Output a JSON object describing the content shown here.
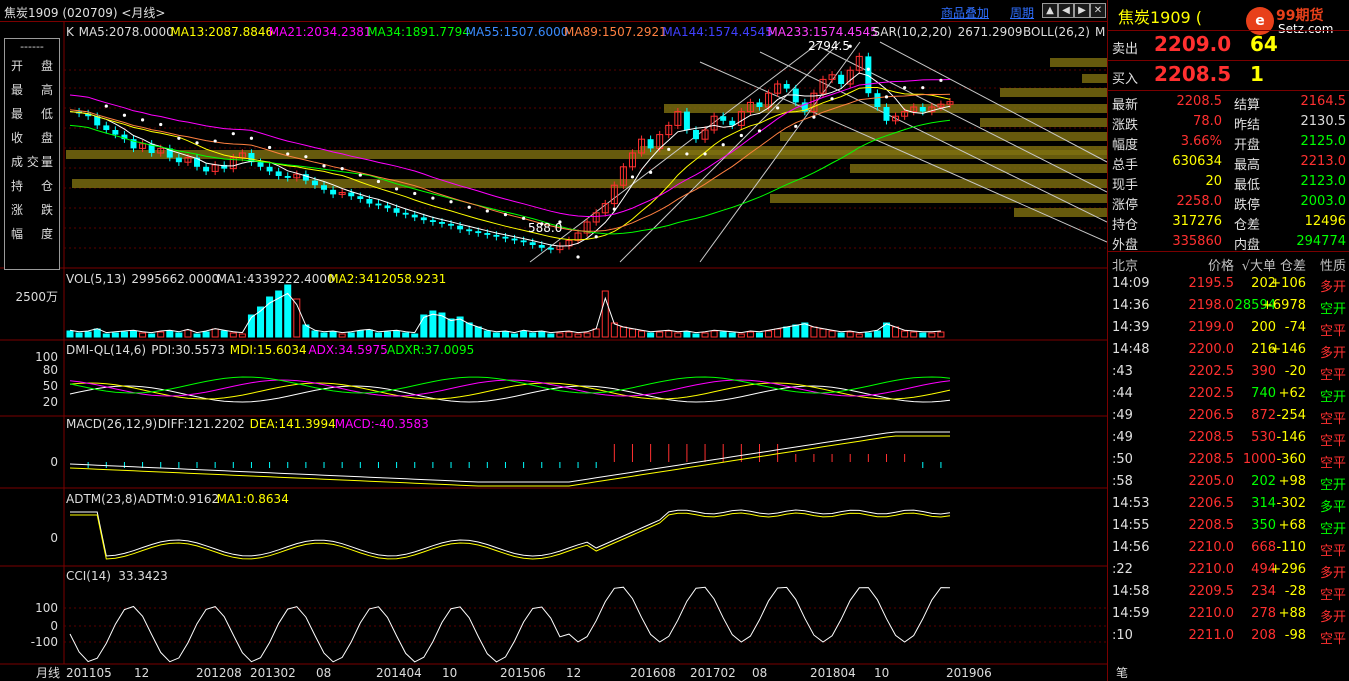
{
  "titlebar": {
    "title": "焦炭1909 (020709) <月线>",
    "overlay_link": "商品叠加",
    "period_link": "周期"
  },
  "side_panel": {
    "dashes": "------",
    "rows": [
      {
        "a": "开",
        "b": "盘"
      },
      {
        "a": "最",
        "b": "高"
      },
      {
        "a": "最",
        "b": "低"
      },
      {
        "a": "收",
        "b": "盘"
      },
      {
        "a": "成 交",
        "b": "量"
      },
      {
        "a": "持",
        "b": "仓"
      },
      {
        "a": "涨",
        "b": "跌"
      },
      {
        "a": "幅",
        "b": "度"
      }
    ]
  },
  "main_chart": {
    "ma_legend": [
      {
        "text": "K",
        "color": "#dddddd"
      },
      {
        "text": "MA5:2078.0000",
        "color": "#dddddd"
      },
      {
        "text": "MA13:2087.8846",
        "color": "#ffff00"
      },
      {
        "text": "MA21:2034.2381",
        "color": "#ff00ff"
      },
      {
        "text": "MA34:1891.7794",
        "color": "#00ff00"
      },
      {
        "text": "MA55:1507.6000",
        "color": "#3a8cff"
      },
      {
        "text": "MA89:1507.2921",
        "color": "#ff8040"
      },
      {
        "text": "MA144:1574.4545",
        "color": "#4040ff"
      },
      {
        "text": "MA233:1574.4545",
        "color": "#ff40ff"
      },
      {
        "text": "SAR(10,2,20)",
        "color": "#dddddd"
      },
      {
        "text": "2671.2909",
        "color": "#dddddd"
      },
      {
        "text": "BOLL(26,2)",
        "color": "#dddddd"
      },
      {
        "text": "M",
        "color": "#dddddd"
      }
    ],
    "high_label": "2794.5",
    "low_label": "588.0"
  },
  "vol_pane": {
    "legend": [
      {
        "text": "VOL(5,13)",
        "color": "#dddddd"
      },
      {
        "text": "2995662.0000",
        "color": "#dddddd"
      },
      {
        "text": "MA1:4339222.4000",
        "color": "#dddddd"
      },
      {
        "text": "MA2:3412058.9231",
        "color": "#ffff00"
      }
    ],
    "y_label": "2500万"
  },
  "dmi_pane": {
    "legend": [
      {
        "text": "DMI-QL(14,6)",
        "color": "#dddddd"
      },
      {
        "text": "PDI:30.5573",
        "color": "#dddddd"
      },
      {
        "text": "MDI:15.6034",
        "color": "#ffff00"
      },
      {
        "text": "ADX:34.5975",
        "color": "#ff00ff"
      },
      {
        "text": "ADXR:37.0095",
        "color": "#00ff00"
      }
    ],
    "y_labels": [
      "100",
      "80",
      "50",
      "20"
    ]
  },
  "macd_pane": {
    "legend": [
      {
        "text": "MACD(26,12,9)",
        "color": "#dddddd"
      },
      {
        "text": "DIFF:121.2202",
        "color": "#dddddd"
      },
      {
        "text": "DEA:141.3994",
        "color": "#ffff00"
      },
      {
        "text": "MACD:-40.3583",
        "color": "#ff00ff"
      }
    ],
    "y_label": "0"
  },
  "adtm_pane": {
    "legend": [
      {
        "text": "ADTM(23,8)",
        "color": "#dddddd"
      },
      {
        "text": "ADTM:0.9162",
        "color": "#dddddd"
      },
      {
        "text": "MA1:0.8634",
        "color": "#ffff00"
      }
    ],
    "y_label": "0"
  },
  "cci_pane": {
    "legend": [
      {
        "text": "CCI(14)",
        "color": "#dddddd"
      },
      {
        "text": "33.3423",
        "color": "#dddddd"
      }
    ],
    "y_labels": [
      "100",
      "0",
      "-100"
    ]
  },
  "x_axis": {
    "period_label": "月线",
    "labels": [
      "201105",
      "12",
      "201208",
      "201302",
      "08",
      "201404",
      "10",
      "201506",
      "12",
      "201608",
      "201702",
      "08",
      "201804",
      "10",
      "201906"
    ]
  },
  "right_panel": {
    "title": "焦炭1909 (",
    "logo_glyph": "e",
    "logo_brand": "99期货",
    "logo_site": "Setz.com",
    "sell": {
      "label": "卖出",
      "price": "2209.0",
      "volume": "64"
    },
    "buy": {
      "label": "买入",
      "price": "2208.5",
      "volume": "1"
    },
    "quotes": [
      {
        "l1": "最新",
        "v1": "2208.5",
        "c1": "#ff3030",
        "l2": "结算",
        "v2": "2164.5",
        "c2": "#ff3030"
      },
      {
        "l1": "涨跌",
        "v1": "78.0",
        "c1": "#ff3030",
        "l2": "昨结",
        "v2": "2130.5",
        "c2": "#dddddd"
      },
      {
        "l1": "幅度",
        "v1": "3.66%",
        "c1": "#ff3030",
        "l2": "开盘",
        "v2": "2125.0",
        "c2": "#00ff00"
      },
      {
        "l1": "总手",
        "v1": "630634",
        "c1": "#ffff00",
        "l2": "最高",
        "v2": "2213.0",
        "c2": "#ff3030"
      },
      {
        "l1": "现手",
        "v1": "20",
        "c1": "#ffff00",
        "l2": "最低",
        "v2": "2123.0",
        "c2": "#00ff00"
      },
      {
        "l1": "涨停",
        "v1": "2258.0",
        "c1": "#ff3030",
        "l2": "跌停",
        "v2": "2003.0",
        "c2": "#00ff00"
      },
      {
        "l1": "持仓",
        "v1": "317276",
        "c1": "#ffff00",
        "l2": "仓差",
        "v2": "12496",
        "c2": "#ffff00"
      },
      {
        "l1": "外盘",
        "v1": "335860",
        "c1": "#ff3030",
        "l2": "内盘",
        "v2": "294774",
        "c2": "#00ff00"
      }
    ],
    "tick_header": {
      "location": "北京",
      "price": "价格",
      "big": "√大单",
      "diff": "仓差",
      "nature": "性质"
    },
    "ticks": [
      {
        "time": "14:09",
        "price": "2195.5",
        "vol": "202",
        "vc": "#ffff00",
        "diff": "+106",
        "nat": "多开",
        "nc": "#ff3030"
      },
      {
        "time": "14:36",
        "price": "2198.0",
        "vol": "28594",
        "vc": "#00ff00",
        "diff": "+6978",
        "nat": "空开",
        "nc": "#00ff00"
      },
      {
        "time": "14:39",
        "price": "2199.0",
        "vol": "200",
        "vc": "#ffff00",
        "diff": "-74",
        "nat": "空平",
        "nc": "#ff3030"
      },
      {
        "time": "14:48",
        "price": "2200.0",
        "vol": "216",
        "vc": "#ffff00",
        "diff": "+146",
        "nat": "多开",
        "nc": "#ff3030"
      },
      {
        "time": ":43",
        "price": "2202.5",
        "vol": "390",
        "vc": "#ff3030",
        "diff": "-20",
        "nat": "空平",
        "nc": "#ff3030"
      },
      {
        "time": ":44",
        "price": "2202.5",
        "vol": "740",
        "vc": "#00ff00",
        "diff": "+62",
        "nat": "空开",
        "nc": "#00ff00"
      },
      {
        "time": ":49",
        "price": "2206.5",
        "vol": "872",
        "vc": "#ff3030",
        "diff": "-254",
        "nat": "空平",
        "nc": "#ff3030"
      },
      {
        "time": ":49",
        "price": "2208.5",
        "vol": "530",
        "vc": "#ff3030",
        "diff": "-146",
        "nat": "空平",
        "nc": "#ff3030"
      },
      {
        "time": ":50",
        "price": "2208.5",
        "vol": "1000",
        "vc": "#ff3030",
        "diff": "-360",
        "nat": "空平",
        "nc": "#ff3030"
      },
      {
        "time": ":58",
        "price": "2205.0",
        "vol": "202",
        "vc": "#00ff00",
        "diff": "+98",
        "nat": "空开",
        "nc": "#00ff00"
      },
      {
        "time": "14:53",
        "price": "2206.5",
        "vol": "314",
        "vc": "#00ff00",
        "diff": "-302",
        "nat": "多平",
        "nc": "#00ff00"
      },
      {
        "time": "14:55",
        "price": "2208.5",
        "vol": "350",
        "vc": "#00ff00",
        "diff": "+68",
        "nat": "空开",
        "nc": "#00ff00"
      },
      {
        "time": "14:56",
        "price": "2210.0",
        "vol": "668",
        "vc": "#ff3030",
        "diff": "-110",
        "nat": "空平",
        "nc": "#ff3030"
      },
      {
        "time": ":22",
        "price": "2210.0",
        "vol": "494",
        "vc": "#ff3030",
        "diff": "+296",
        "nat": "多开",
        "nc": "#ff3030"
      },
      {
        "time": "14:58",
        "price": "2209.5",
        "vol": "234",
        "vc": "#ff3030",
        "diff": "-28",
        "nat": "空平",
        "nc": "#ff3030"
      },
      {
        "time": "14:59",
        "price": "2210.0",
        "vol": "278",
        "vc": "#ff3030",
        "diff": "+88",
        "nat": "多开",
        "nc": "#ff3030"
      },
      {
        "time": ":10",
        "price": "2211.0",
        "vol": "208",
        "vc": "#ff3030",
        "diff": "-98",
        "nat": "空平",
        "nc": "#ff3030"
      }
    ],
    "bottom_tab": "笔"
  },
  "colors": {
    "up": "#ff3030",
    "down": "#00ffff",
    "grid": "#7a0000",
    "profile": "#807010"
  }
}
